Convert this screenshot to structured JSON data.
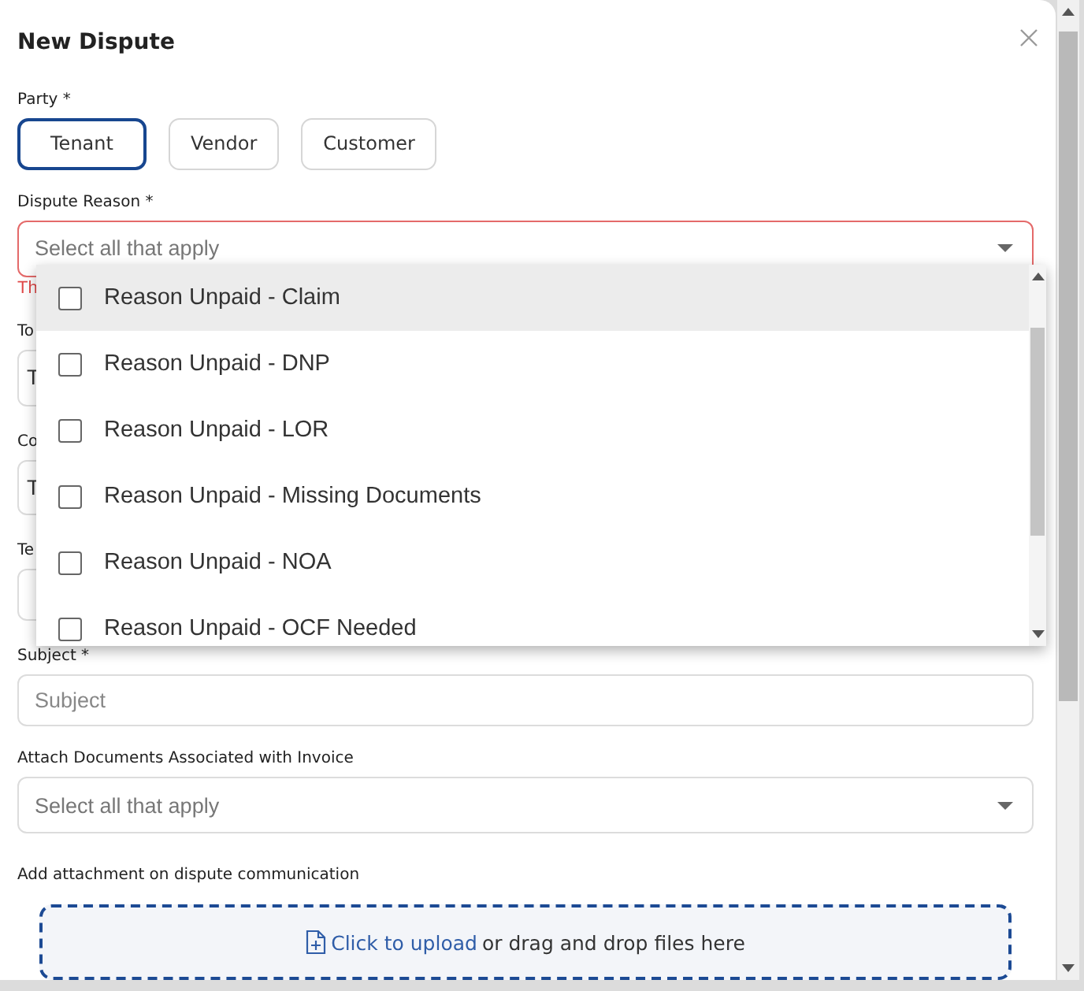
{
  "dialog": {
    "title": "New Dispute"
  },
  "party": {
    "label": "Party *",
    "options": [
      {
        "label": "Tenant",
        "selected": true
      },
      {
        "label": "Vendor",
        "selected": false
      },
      {
        "label": "Customer",
        "selected": false
      }
    ]
  },
  "dispute_reason": {
    "label": "Dispute Reason *",
    "placeholder": "Select all that apply",
    "invalid": true,
    "error": "Th",
    "menu": {
      "items": [
        {
          "label": "Reason Unpaid - Claim",
          "checked": false,
          "highlighted": true
        },
        {
          "label": "Reason Unpaid - DNP",
          "checked": false,
          "highlighted": false
        },
        {
          "label": "Reason Unpaid - LOR",
          "checked": false,
          "highlighted": false
        },
        {
          "label": "Reason Unpaid - Missing Documents",
          "checked": false,
          "highlighted": false
        },
        {
          "label": "Reason Unpaid - NOA",
          "checked": false,
          "highlighted": false
        },
        {
          "label": "Reason Unpaid - OCF Needed",
          "checked": false,
          "highlighted": false
        }
      ]
    }
  },
  "covered_fields": [
    {
      "label": "To",
      "value": "T"
    },
    {
      "label": "Co",
      "value": "T"
    },
    {
      "label": "Te"
    }
  ],
  "subject": {
    "label": "Subject *",
    "placeholder": "Subject"
  },
  "attach_documents": {
    "label": "Attach Documents Associated with Invoice",
    "placeholder": "Select all that apply"
  },
  "attachment": {
    "label": "Add attachment on dispute communication",
    "link": "Click to upload",
    "text": "or drag and drop files here"
  }
}
